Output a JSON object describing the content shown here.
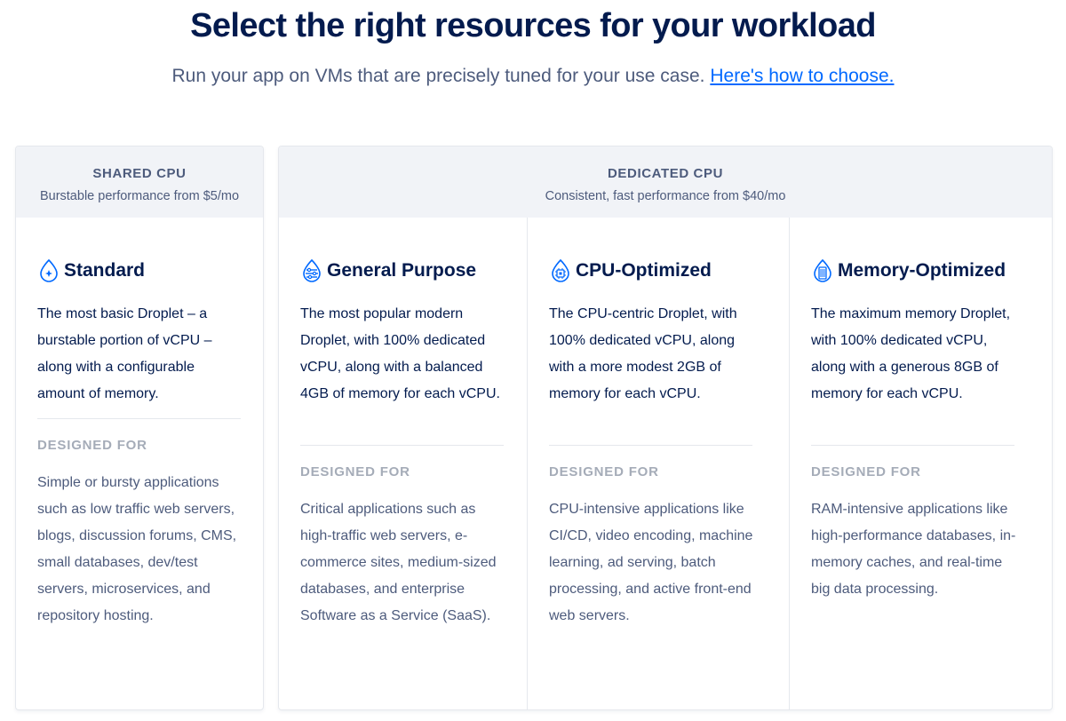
{
  "hero": {
    "title": "Select the right resources for your workload",
    "subtitle": "Run your app on VMs that are precisely tuned for your use case.",
    "link": "Here's how to choose."
  },
  "shared": {
    "title": "SHARED CPU",
    "tagline": "Burstable performance from $5/mo",
    "plans": [
      {
        "name": "Standard",
        "icon": "droplet-icon",
        "description": "The most basic Droplet – a burstable portion of vCPU – along with a configurable amount of memory.",
        "designed_label": "DESIGNED FOR",
        "designed_for": "Simple or bursty applications such as low traffic web servers, blogs, discussion forums, CMS, small databases, dev/test servers, microservices, and repository hosting."
      }
    ]
  },
  "dedicated": {
    "title": "DEDICATED CPU",
    "tagline": "Consistent, fast performance from $40/mo",
    "plans": [
      {
        "name": "General Purpose",
        "icon": "balance-droplet-icon",
        "description": "The most popular modern Droplet, with 100% dedicated vCPU, along with a balanced 4GB of memory for each vCPU.",
        "designed_label": "DESIGNED FOR",
        "designed_for": "Critical applications such as high-traffic web servers, e-commerce sites, medium-sized databases, and enterprise Software as a Service (SaaS)."
      },
      {
        "name": "CPU-Optimized",
        "icon": "cpu-droplet-icon",
        "description": "The CPU-centric Droplet, with 100% dedicated vCPU, along with a more modest 2GB of memory for each vCPU.",
        "designed_label": "DESIGNED FOR",
        "designed_for": "CPU-intensive applications like CI/CD, video encoding, machine learning, ad serving, batch processing, and active front-end web servers."
      },
      {
        "name": "Memory-Optimized",
        "icon": "memory-droplet-icon",
        "description": "The maximum memory Droplet, with 100% dedicated vCPU, along with a generous 8GB of memory for each vCPU.",
        "designed_label": "DESIGNED FOR",
        "designed_for": "RAM-intensive applications like high-performance databases, in-memory caches, and real-time big data processing."
      }
    ]
  },
  "colors": {
    "heading": "#031b4e",
    "muted": "#4d5b7c",
    "label": "#a5acb8",
    "link": "#0069ff",
    "icon": "#0069ff",
    "header_bg": "#f1f3f7",
    "border": "#e5e8ed"
  }
}
